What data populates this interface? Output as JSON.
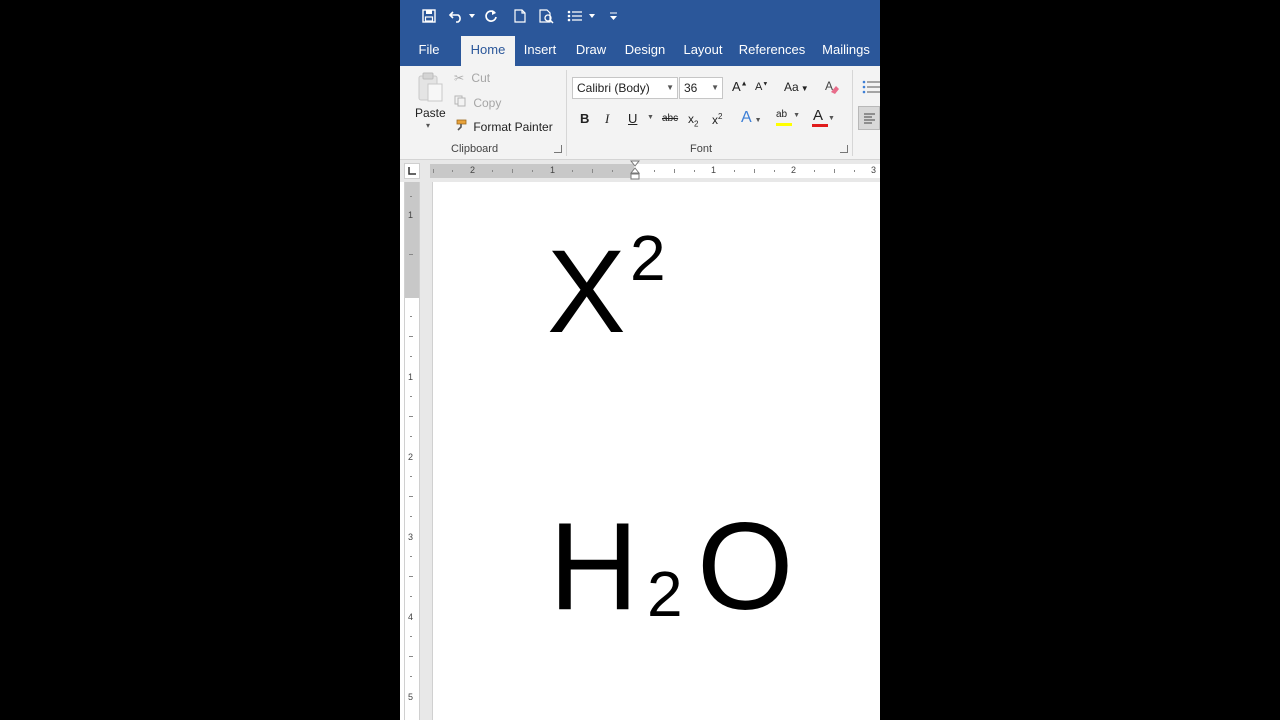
{
  "colors": {
    "title_bar": "#2b579a",
    "ribbon": "#f3f3f3",
    "page": "#ffffff",
    "font_color_bar": "#e01b1b",
    "highlight_bar": "#ffff00"
  },
  "quick_access": {
    "icons": [
      "save-icon",
      "undo-icon",
      "redo-icon",
      "new-document-icon",
      "print-preview-icon",
      "bullets-icon",
      "customize-icon"
    ]
  },
  "tabs": [
    "File",
    "Home",
    "Insert",
    "Draw",
    "Design",
    "Layout",
    "References",
    "Mailings"
  ],
  "active_tab": "Home",
  "clipboard": {
    "paste_label": "Paste",
    "cut_label": "Cut",
    "copy_label": "Copy",
    "format_painter_label": "Format Painter",
    "group_label": "Clipboard"
  },
  "font": {
    "font_name": "Calibri (Body)",
    "font_size": "36",
    "group_label": "Font",
    "bold": "B",
    "italic": "I",
    "underline": "U",
    "strikethrough": "abc",
    "subscript_base": "x",
    "subscript_sub": "2",
    "superscript_base": "x",
    "superscript_sup": "2",
    "grow_font": "A",
    "shrink_font": "A",
    "change_case": "Aa",
    "text_effects": "A",
    "highlight": "ab",
    "font_color": "A"
  },
  "ruler": {
    "horizontal_labels": [
      "2",
      "1",
      "1",
      "2",
      "3"
    ],
    "vertical_labels": [
      "1",
      "1",
      "2",
      "3",
      "4",
      "5"
    ]
  },
  "document": {
    "line1_base": "X",
    "line1_sup": "2",
    "line2_part1": "H",
    "line2_sub": "2",
    "line2_part2": "O"
  }
}
